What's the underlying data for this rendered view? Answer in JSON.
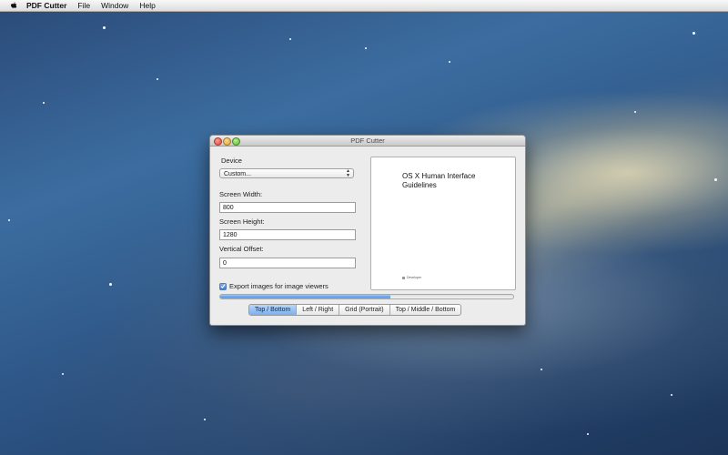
{
  "menubar": {
    "app_name": "PDF Cutter",
    "items": [
      "File",
      "Window",
      "Help"
    ]
  },
  "window": {
    "title": "PDF Cutter",
    "device_label": "Device",
    "device_value": "Custom...",
    "screen_width_label": "Screen Width:",
    "screen_width_value": "800",
    "screen_height_label": "Screen Height:",
    "screen_height_value": "1280",
    "vertical_offset_label": "Vertical Offset:",
    "vertical_offset_value": "0",
    "export_checkbox_label": "Export images for image viewers",
    "export_checked": true,
    "progress_fraction": 0.58,
    "preview": {
      "title": "OS X Human Interface Guidelines",
      "footer": "Developer"
    },
    "segments": [
      {
        "label": "Top / Bottom",
        "selected": true
      },
      {
        "label": "Left / Right",
        "selected": false
      },
      {
        "label": "Grid (Portrait)",
        "selected": false
      },
      {
        "label": "Top / Middle / Bottom",
        "selected": false
      }
    ]
  },
  "colors": {
    "accent": "#5c9be6",
    "desktop": "#2b5282"
  }
}
